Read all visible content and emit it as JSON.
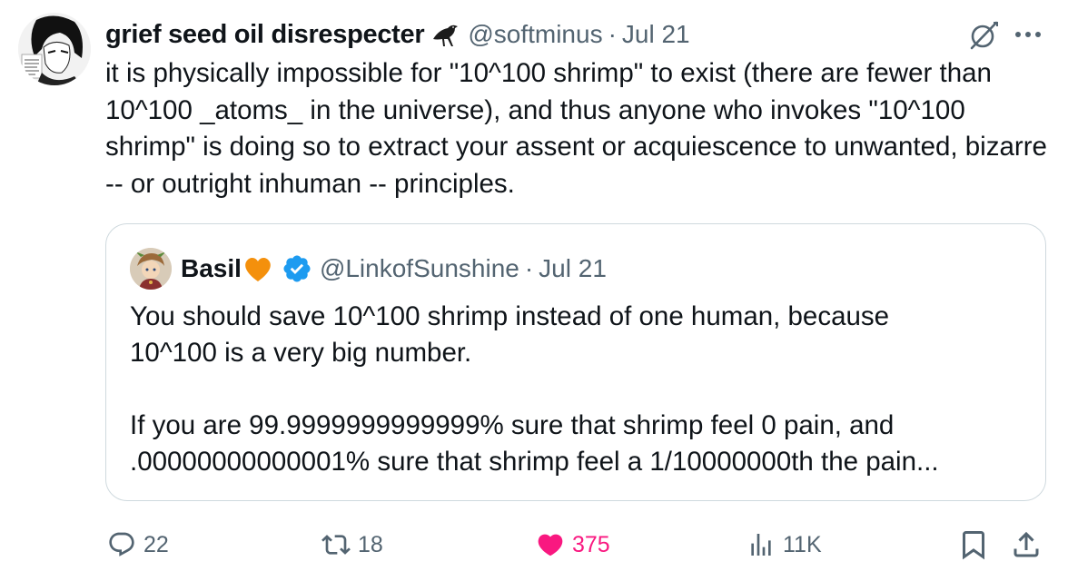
{
  "tweet": {
    "author": {
      "display_name": "grief seed oil disrespecter",
      "handle": "@softminus",
      "name_emoji_icon": "crow-icon"
    },
    "separator": "·",
    "date": "Jul 21",
    "text": "it is physically impossible for \"10^100 shrimp\" to exist (there are fewer than 10^100 _atoms_ in the universe), and thus anyone who invokes \"10^100 shrimp\" is doing so to extract your assent or acquiescence to unwanted, bizarre --  or outright inhuman -- principles.",
    "header_icons": [
      "grok-icon",
      "more-icon"
    ]
  },
  "quote": {
    "author": {
      "display_name": "Basil",
      "name_emoji_icon": "orange-heart-icon",
      "verified_icon": "verified-badge-icon",
      "handle": "@LinkofSunshine"
    },
    "separator": "·",
    "date": "Jul 21",
    "text": "You should save 10^100 shrimp instead of one human, because\n10^100 is a very big number.\n\nIf you are 99.9999999999999% sure that shrimp feel 0 pain, and\n.00000000000001% sure that shrimp feel a 1/10000000th the pain..."
  },
  "actions": {
    "replies": "22",
    "reposts": "18",
    "likes": "375",
    "views": "11K",
    "icons": [
      "reply-icon",
      "repost-icon",
      "like-icon",
      "views-icon",
      "bookmark-icon",
      "share-icon"
    ],
    "like_color": "#f91880",
    "muted_color": "#536471"
  }
}
